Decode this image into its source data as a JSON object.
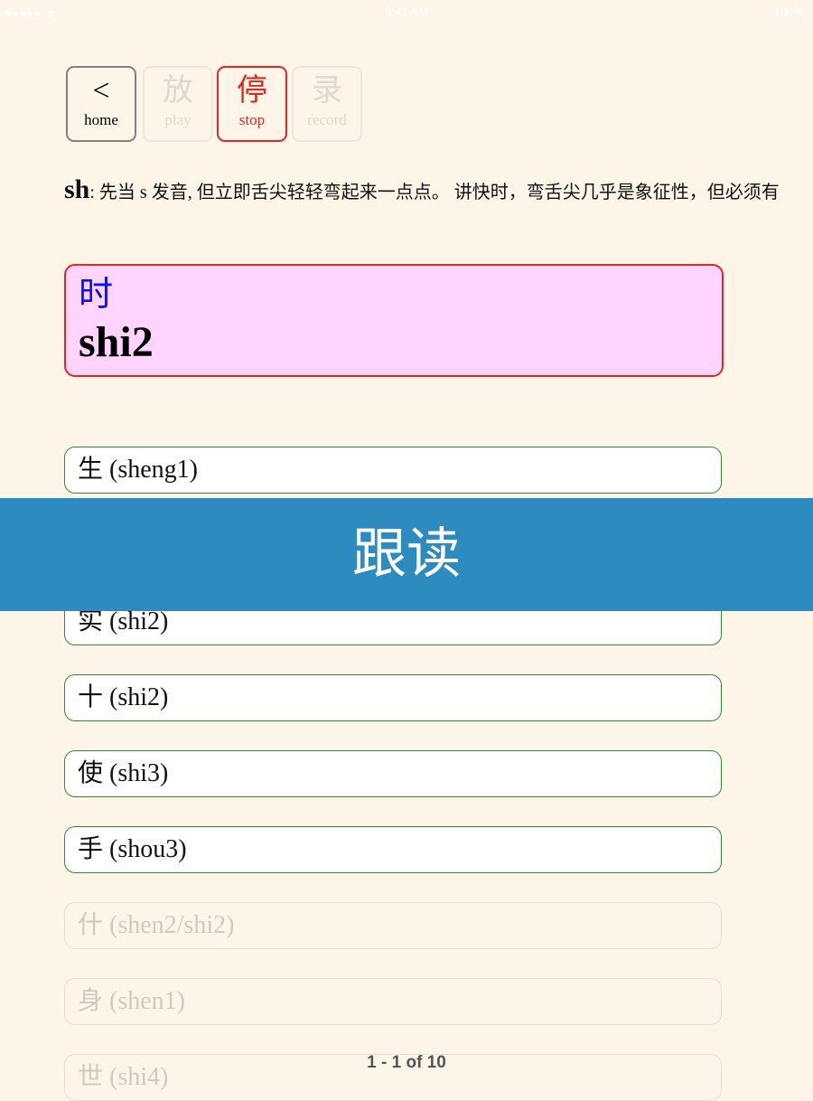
{
  "status": {
    "time": "9:41 AM",
    "battery": "100%",
    "signal": "●●●●● ᯤ"
  },
  "toolbar": {
    "home": {
      "glyph": "<",
      "label": "home"
    },
    "play": {
      "glyph": "放",
      "label": "play"
    },
    "stop": {
      "glyph": "停",
      "label": "stop"
    },
    "record": {
      "glyph": "录",
      "label": "record"
    }
  },
  "description": {
    "sound": "sh",
    "text": ": 先当 s 发音, 但立即舌尖轻轻弯起来一点点。 讲快时，弯舌尖几乎是象征性，但必须有"
  },
  "current": {
    "hanzi": "时",
    "pinyin": "shi2"
  },
  "words": [
    "生 (sheng1)",
    "实 (shi2)",
    "十 (shi2)",
    "使 (shi3)",
    "手 (shou3)",
    "什 (shen2/shi2)",
    "身 (shen1)",
    "世 (shi4)"
  ],
  "banner": "跟读",
  "pager": "1 - 1 of 10",
  "colors": {
    "accent": "#e0281e",
    "banner": "#2e8bc0",
    "card": "#ffd4ff",
    "row_border": "#2e8b2e"
  }
}
